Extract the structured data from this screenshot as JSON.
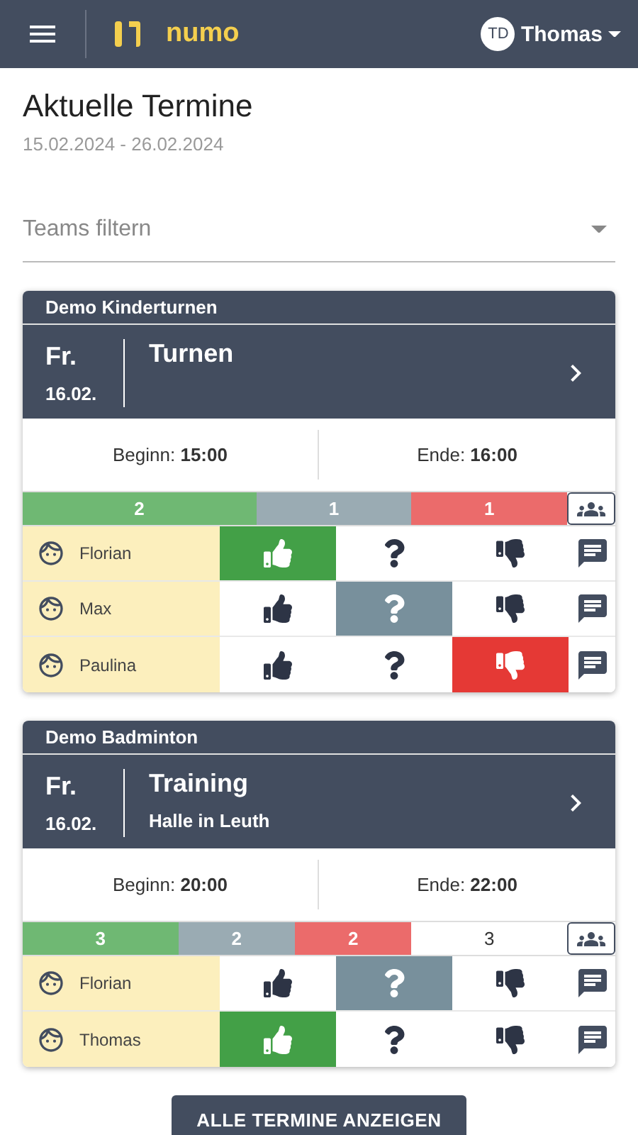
{
  "header": {
    "brand": "numo",
    "user_initials": "TD",
    "user_name": "Thomas"
  },
  "page": {
    "title": "Aktuelle Termine",
    "date_range": "15.02.2024 - 26.02.2024"
  },
  "filter": {
    "placeholder": "Teams filtern"
  },
  "cards": [
    {
      "team": "Demo Kinderturnen",
      "weekday": "Fr.",
      "date": "16.02.",
      "title": "Turnen",
      "start": "Beginn: **15:00**",
      "end": "Ende: **16:00**",
      "summary": [
        {
          "kind": "yes",
          "count": "2"
        },
        {
          "kind": "maybe",
          "count": "1"
        },
        {
          "kind": "no",
          "count": "1"
        }
      ],
      "members": [
        {
          "name": "Florian",
          "choices": [
            {
              "kind": "yes",
              "selected": true
            },
            {
              "kind": "maybe",
              "selected": false
            },
            {
              "kind": "no",
              "selected": false
            }
          ]
        },
        {
          "name": "Max",
          "choices": [
            {
              "kind": "yes",
              "selected": false
            },
            {
              "kind": "maybe",
              "selected": true
            },
            {
              "kind": "no",
              "selected": false
            }
          ]
        },
        {
          "name": "Paulina",
          "choices": [
            {
              "kind": "yes",
              "selected": false
            },
            {
              "kind": "maybe",
              "selected": false
            },
            {
              "kind": "no",
              "selected": true
            }
          ]
        }
      ]
    },
    {
      "team": "Demo Badminton",
      "weekday": "Fr.",
      "date": "16.02.",
      "title": "Training",
      "location": "Halle in Leuth",
      "start": "Beginn: **20:00**",
      "end": "Ende: **22:00**",
      "summary": [
        {
          "kind": "yes",
          "count": "3"
        },
        {
          "kind": "maybe",
          "count": "2"
        },
        {
          "kind": "no",
          "count": "2"
        },
        {
          "kind": "open",
          "count": "3"
        }
      ],
      "members": [
        {
          "name": "Florian",
          "choices": [
            {
              "kind": "yes",
              "selected": false
            },
            {
              "kind": "maybe",
              "selected": true
            },
            {
              "kind": "no",
              "selected": false
            }
          ]
        },
        {
          "name": "Thomas",
          "choices": [
            {
              "kind": "yes",
              "selected": true
            },
            {
              "kind": "maybe",
              "selected": false
            },
            {
              "kind": "no",
              "selected": false
            }
          ]
        }
      ]
    }
  ],
  "button": "ALLE TERMINE ANZEIGEN"
}
